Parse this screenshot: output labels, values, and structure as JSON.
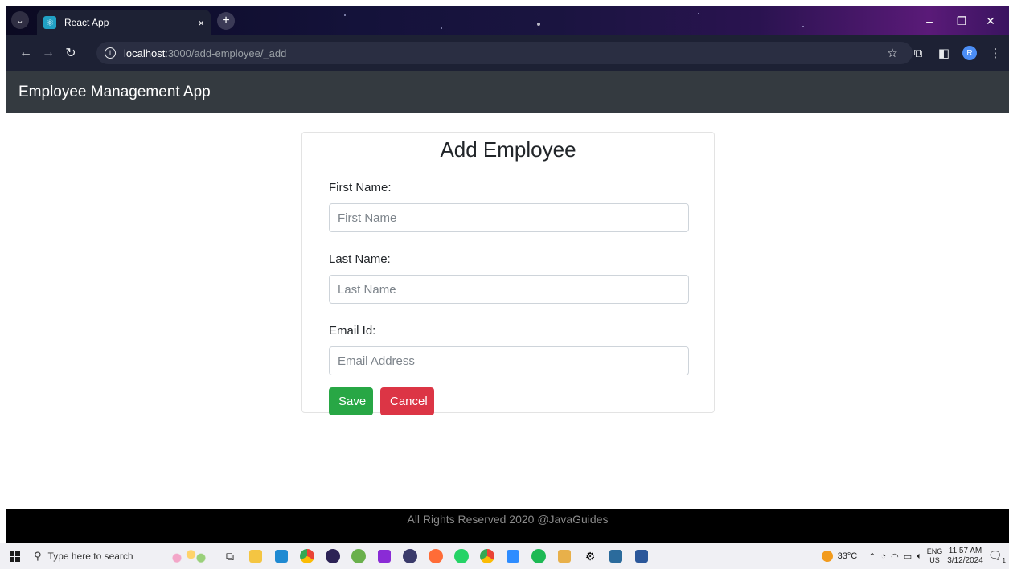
{
  "browser": {
    "tab_title": "React App",
    "tab_close": "×",
    "new_tab": "+",
    "url_host": "localhost",
    "url_path": ":3000/add-employee/_add",
    "window_controls": [
      "–",
      "❐",
      "✕"
    ],
    "profile_initial": "R"
  },
  "app": {
    "brand": "Employee Management App"
  },
  "form": {
    "title": "Add Employee",
    "fields": [
      {
        "label": "First Name:",
        "placeholder": "First Name"
      },
      {
        "label": "Last Name:",
        "placeholder": "Last Name"
      },
      {
        "label": "Email Id:",
        "placeholder": "Email Address"
      }
    ],
    "save_label": "Save",
    "cancel_label": "Cancel"
  },
  "footer": {
    "text": "All Rights Reserved 2020 @JavaGuides"
  },
  "taskbar": {
    "search_placeholder": "Type here to search",
    "weather": "33°C",
    "lang_top": "ENG",
    "lang_bottom": "US",
    "time": "11:57 AM",
    "date": "3/12/2024",
    "notification_count": "1"
  },
  "colors": {
    "header_bg": "#343a40",
    "save": "#28a745",
    "cancel": "#dc3545",
    "footer_bg": "#000000"
  }
}
